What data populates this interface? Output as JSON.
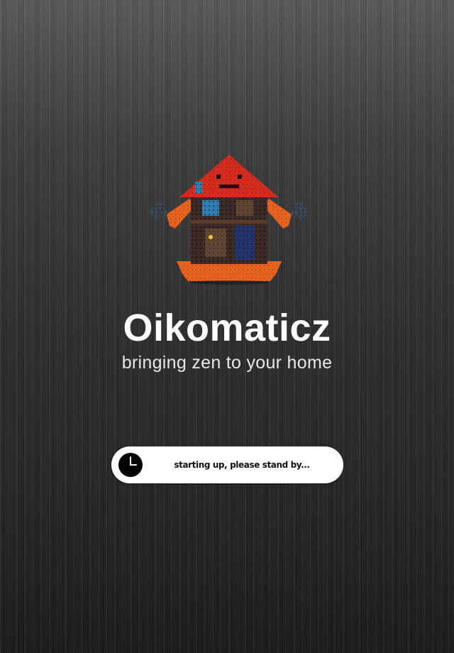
{
  "splash": {
    "app_title": "Oikomaticz",
    "tagline": "bringing zen to your home",
    "status_text": "starting up, please stand by...",
    "mascot_icon": "bead-house-mascot-icon",
    "status_icon": "clock-icon"
  },
  "colors": {
    "background": "#2e2e2e",
    "title_text": "#ffffff",
    "tagline_text": "#e8e8e8",
    "status_pill_background": "#ffffff",
    "status_text": "#111111",
    "mascot_roof": "#d92a1e",
    "mascot_arms": "#f0621c",
    "mascot_body": "#3a2a28",
    "mascot_windows": "#2f86b8"
  }
}
